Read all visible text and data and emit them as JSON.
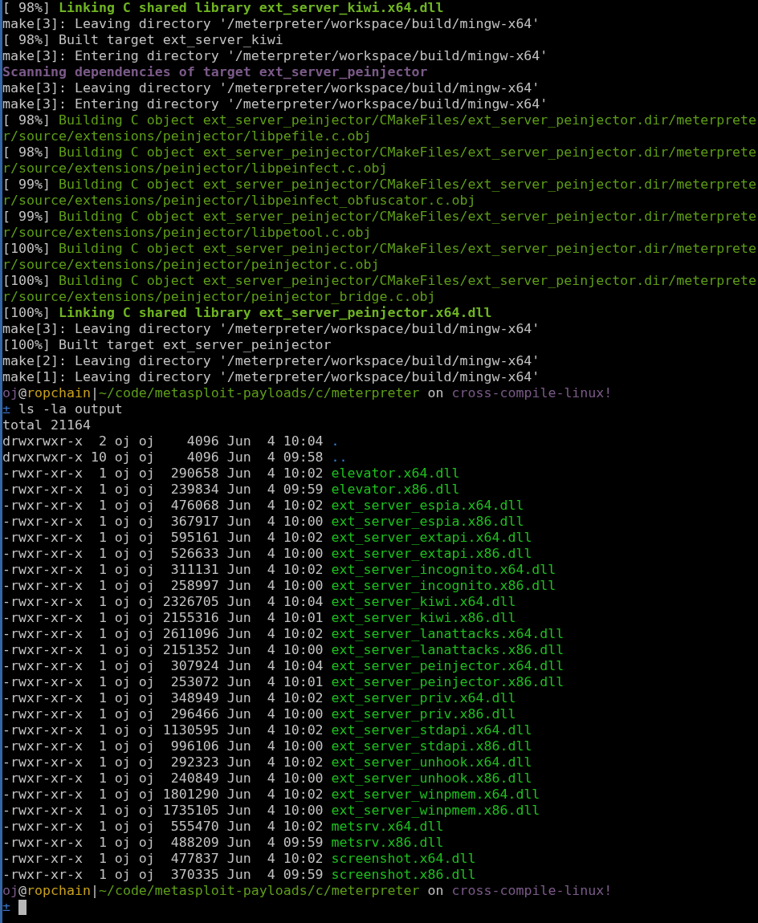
{
  "lines": [
    {
      "segments": [
        {
          "text": "[ 98%] ",
          "kind": "plain"
        },
        {
          "text": "Linking C shared library ext_server_kiwi.x64.dll",
          "kind": "link"
        }
      ]
    },
    {
      "segments": [
        {
          "text": "make[3]: Leaving directory '/meterpreter/workspace/build/mingw-x64'",
          "kind": "plain"
        }
      ]
    },
    {
      "segments": [
        {
          "text": "[ 98%] Built target ext_server_kiwi",
          "kind": "plain"
        }
      ]
    },
    {
      "segments": [
        {
          "text": "make[3]: Entering directory '/meterpreter/workspace/build/mingw-x64'",
          "kind": "plain"
        }
      ]
    },
    {
      "segments": [
        {
          "text": "Scanning dependencies of target ext_server_peinjector",
          "kind": "scan"
        }
      ]
    },
    {
      "segments": [
        {
          "text": "make[3]: Leaving directory '/meterpreter/workspace/build/mingw-x64'",
          "kind": "plain"
        }
      ]
    },
    {
      "segments": [
        {
          "text": "make[3]: Entering directory '/meterpreter/workspace/build/mingw-x64'",
          "kind": "plain"
        }
      ]
    },
    {
      "segments": [
        {
          "text": "[ 98%] ",
          "kind": "plain"
        },
        {
          "text": "Building C object ext_server_peinjector/CMakeFiles/ext_server_peinjector.dir/meterprete",
          "kind": "build"
        }
      ]
    },
    {
      "segments": [
        {
          "text": "r/source/extensions/peinjector/libpefile.c.obj",
          "kind": "build"
        }
      ]
    },
    {
      "segments": [
        {
          "text": "[ 98%] ",
          "kind": "plain"
        },
        {
          "text": "Building C object ext_server_peinjector/CMakeFiles/ext_server_peinjector.dir/meterprete",
          "kind": "build"
        }
      ]
    },
    {
      "segments": [
        {
          "text": "r/source/extensions/peinjector/libpeinfect.c.obj",
          "kind": "build"
        }
      ]
    },
    {
      "segments": [
        {
          "text": "[ 99%] ",
          "kind": "plain"
        },
        {
          "text": "Building C object ext_server_peinjector/CMakeFiles/ext_server_peinjector.dir/meterprete",
          "kind": "build"
        }
      ]
    },
    {
      "segments": [
        {
          "text": "r/source/extensions/peinjector/libpeinfect_obfuscator.c.obj",
          "kind": "build"
        }
      ]
    },
    {
      "segments": [
        {
          "text": "[ 99%] ",
          "kind": "plain"
        },
        {
          "text": "Building C object ext_server_peinjector/CMakeFiles/ext_server_peinjector.dir/meterprete",
          "kind": "build"
        }
      ]
    },
    {
      "segments": [
        {
          "text": "r/source/extensions/peinjector/libpetool.c.obj",
          "kind": "build"
        }
      ]
    },
    {
      "segments": [
        {
          "text": "[100%] ",
          "kind": "plain"
        },
        {
          "text": "Building C object ext_server_peinjector/CMakeFiles/ext_server_peinjector.dir/meterprete",
          "kind": "build"
        }
      ]
    },
    {
      "segments": [
        {
          "text": "r/source/extensions/peinjector/peinjector.c.obj",
          "kind": "build"
        }
      ]
    },
    {
      "segments": [
        {
          "text": "[100%] ",
          "kind": "plain"
        },
        {
          "text": "Building C object ext_server_peinjector/CMakeFiles/ext_server_peinjector.dir/meterprete",
          "kind": "build"
        }
      ]
    },
    {
      "segments": [
        {
          "text": "r/source/extensions/peinjector/peinjector_bridge.c.obj",
          "kind": "build"
        }
      ]
    },
    {
      "segments": [
        {
          "text": "[100%] ",
          "kind": "plain"
        },
        {
          "text": "Linking C shared library ext_server_peinjector.x64.dll",
          "kind": "link"
        }
      ]
    },
    {
      "segments": [
        {
          "text": "make[3]: Leaving directory '/meterpreter/workspace/build/mingw-x64'",
          "kind": "plain"
        }
      ]
    },
    {
      "segments": [
        {
          "text": "[100%] Built target ext_server_peinjector",
          "kind": "plain"
        }
      ]
    },
    {
      "segments": [
        {
          "text": "make[2]: Leaving directory '/meterpreter/workspace/build/mingw-x64'",
          "kind": "plain"
        }
      ]
    },
    {
      "segments": [
        {
          "text": "make[1]: Leaving directory '/meterpreter/workspace/build/mingw-x64'",
          "kind": "plain"
        }
      ]
    },
    {
      "segments": [
        {
          "text": "oj",
          "kind": "user"
        },
        {
          "text": "@",
          "kind": "plain"
        },
        {
          "text": "ropchain",
          "kind": "host"
        },
        {
          "text": "|",
          "kind": "plain"
        },
        {
          "text": "~/code/metasploit-payloads/c/meterpreter",
          "kind": "path"
        },
        {
          "text": " on ",
          "kind": "plain"
        },
        {
          "text": "cross-compile-linux!",
          "kind": "branch"
        }
      ]
    },
    {
      "segments": [
        {
          "text": "±",
          "kind": "sign"
        },
        {
          "text": " ls -la output",
          "kind": "plain"
        }
      ]
    },
    {
      "segments": [
        {
          "text": "total 21164",
          "kind": "plain"
        }
      ]
    },
    {
      "segments": [
        {
          "text": "drwxrwxr-x  2 oj oj    4096 Jun  4 10:04 ",
          "kind": "plain"
        },
        {
          "text": ".",
          "kind": "dir"
        }
      ]
    },
    {
      "segments": [
        {
          "text": "drwxrwxr-x 10 oj oj    4096 Jun  4 09:58 ",
          "kind": "plain"
        },
        {
          "text": "..",
          "kind": "dir"
        }
      ]
    },
    {
      "segments": [
        {
          "text": "-rwxr-xr-x  1 oj oj  290658 Jun  4 10:02 ",
          "kind": "plain"
        },
        {
          "text": "elevator.x64.dll",
          "kind": "file"
        }
      ]
    },
    {
      "segments": [
        {
          "text": "-rwxr-xr-x  1 oj oj  239834 Jun  4 09:59 ",
          "kind": "plain"
        },
        {
          "text": "elevator.x86.dll",
          "kind": "file"
        }
      ]
    },
    {
      "segments": [
        {
          "text": "-rwxr-xr-x  1 oj oj  476068 Jun  4 10:02 ",
          "kind": "plain"
        },
        {
          "text": "ext_server_espia.x64.dll",
          "kind": "file"
        }
      ]
    },
    {
      "segments": [
        {
          "text": "-rwxr-xr-x  1 oj oj  367917 Jun  4 10:00 ",
          "kind": "plain"
        },
        {
          "text": "ext_server_espia.x86.dll",
          "kind": "file"
        }
      ]
    },
    {
      "segments": [
        {
          "text": "-rwxr-xr-x  1 oj oj  595161 Jun  4 10:02 ",
          "kind": "plain"
        },
        {
          "text": "ext_server_extapi.x64.dll",
          "kind": "file"
        }
      ]
    },
    {
      "segments": [
        {
          "text": "-rwxr-xr-x  1 oj oj  526633 Jun  4 10:00 ",
          "kind": "plain"
        },
        {
          "text": "ext_server_extapi.x86.dll",
          "kind": "file"
        }
      ]
    },
    {
      "segments": [
        {
          "text": "-rwxr-xr-x  1 oj oj  311131 Jun  4 10:02 ",
          "kind": "plain"
        },
        {
          "text": "ext_server_incognito.x64.dll",
          "kind": "file"
        }
      ]
    },
    {
      "segments": [
        {
          "text": "-rwxr-xr-x  1 oj oj  258997 Jun  4 10:00 ",
          "kind": "plain"
        },
        {
          "text": "ext_server_incognito.x86.dll",
          "kind": "file"
        }
      ]
    },
    {
      "segments": [
        {
          "text": "-rwxr-xr-x  1 oj oj 2326705 Jun  4 10:04 ",
          "kind": "plain"
        },
        {
          "text": "ext_server_kiwi.x64.dll",
          "kind": "file"
        }
      ]
    },
    {
      "segments": [
        {
          "text": "-rwxr-xr-x  1 oj oj 2155316 Jun  4 10:01 ",
          "kind": "plain"
        },
        {
          "text": "ext_server_kiwi.x86.dll",
          "kind": "file"
        }
      ]
    },
    {
      "segments": [
        {
          "text": "-rwxr-xr-x  1 oj oj 2611096 Jun  4 10:02 ",
          "kind": "plain"
        },
        {
          "text": "ext_server_lanattacks.x64.dll",
          "kind": "file"
        }
      ]
    },
    {
      "segments": [
        {
          "text": "-rwxr-xr-x  1 oj oj 2151352 Jun  4 10:00 ",
          "kind": "plain"
        },
        {
          "text": "ext_server_lanattacks.x86.dll",
          "kind": "file"
        }
      ]
    },
    {
      "segments": [
        {
          "text": "-rwxr-xr-x  1 oj oj  307924 Jun  4 10:04 ",
          "kind": "plain"
        },
        {
          "text": "ext_server_peinjector.x64.dll",
          "kind": "file"
        }
      ]
    },
    {
      "segments": [
        {
          "text": "-rwxr-xr-x  1 oj oj  253072 Jun  4 10:01 ",
          "kind": "plain"
        },
        {
          "text": "ext_server_peinjector.x86.dll",
          "kind": "file"
        }
      ]
    },
    {
      "segments": [
        {
          "text": "-rwxr-xr-x  1 oj oj  348949 Jun  4 10:02 ",
          "kind": "plain"
        },
        {
          "text": "ext_server_priv.x64.dll",
          "kind": "file"
        }
      ]
    },
    {
      "segments": [
        {
          "text": "-rwxr-xr-x  1 oj oj  296466 Jun  4 10:00 ",
          "kind": "plain"
        },
        {
          "text": "ext_server_priv.x86.dll",
          "kind": "file"
        }
      ]
    },
    {
      "segments": [
        {
          "text": "-rwxr-xr-x  1 oj oj 1130595 Jun  4 10:02 ",
          "kind": "plain"
        },
        {
          "text": "ext_server_stdapi.x64.dll",
          "kind": "file"
        }
      ]
    },
    {
      "segments": [
        {
          "text": "-rwxr-xr-x  1 oj oj  996106 Jun  4 10:00 ",
          "kind": "plain"
        },
        {
          "text": "ext_server_stdapi.x86.dll",
          "kind": "file"
        }
      ]
    },
    {
      "segments": [
        {
          "text": "-rwxr-xr-x  1 oj oj  292323 Jun  4 10:02 ",
          "kind": "plain"
        },
        {
          "text": "ext_server_unhook.x64.dll",
          "kind": "file"
        }
      ]
    },
    {
      "segments": [
        {
          "text": "-rwxr-xr-x  1 oj oj  240849 Jun  4 10:00 ",
          "kind": "plain"
        },
        {
          "text": "ext_server_unhook.x86.dll",
          "kind": "file"
        }
      ]
    },
    {
      "segments": [
        {
          "text": "-rwxr-xr-x  1 oj oj 1801290 Jun  4 10:02 ",
          "kind": "plain"
        },
        {
          "text": "ext_server_winpmem.x64.dll",
          "kind": "file"
        }
      ]
    },
    {
      "segments": [
        {
          "text": "-rwxr-xr-x  1 oj oj 1735105 Jun  4 10:00 ",
          "kind": "plain"
        },
        {
          "text": "ext_server_winpmem.x86.dll",
          "kind": "file"
        }
      ]
    },
    {
      "segments": [
        {
          "text": "-rwxr-xr-x  1 oj oj  555470 Jun  4 10:02 ",
          "kind": "plain"
        },
        {
          "text": "metsrv.x64.dll",
          "kind": "file"
        }
      ]
    },
    {
      "segments": [
        {
          "text": "-rwxr-xr-x  1 oj oj  488209 Jun  4 09:59 ",
          "kind": "plain"
        },
        {
          "text": "metsrv.x86.dll",
          "kind": "file"
        }
      ]
    },
    {
      "segments": [
        {
          "text": "-rwxr-xr-x  1 oj oj  477837 Jun  4 10:02 ",
          "kind": "plain"
        },
        {
          "text": "screenshot.x64.dll",
          "kind": "file"
        }
      ]
    },
    {
      "segments": [
        {
          "text": "-rwxr-xr-x  1 oj oj  370335 Jun  4 09:59 ",
          "kind": "plain"
        },
        {
          "text": "screenshot.x86.dll",
          "kind": "file"
        }
      ]
    },
    {
      "segments": [
        {
          "text": "oj",
          "kind": "user"
        },
        {
          "text": "@",
          "kind": "plain"
        },
        {
          "text": "ropchain",
          "kind": "host"
        },
        {
          "text": "|",
          "kind": "plain"
        },
        {
          "text": "~/code/metasploit-payloads/c/meterpreter",
          "kind": "path"
        },
        {
          "text": " on ",
          "kind": "plain"
        },
        {
          "text": "cross-compile-linux!",
          "kind": "branch"
        }
      ]
    },
    {
      "segments": [
        {
          "text": "±",
          "kind": "sign"
        }
      ],
      "cursor": true
    }
  ]
}
